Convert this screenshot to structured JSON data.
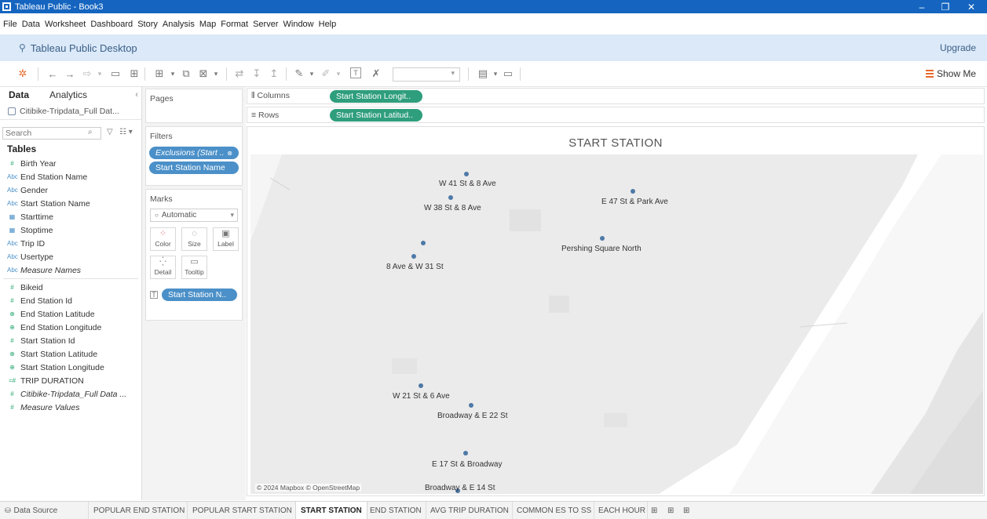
{
  "window": {
    "title": "Tableau Public - Book3",
    "controls": {
      "minimize": "–",
      "restore": "❐",
      "close": "✕"
    }
  },
  "menu": [
    "File",
    "Data",
    "Worksheet",
    "Dashboard",
    "Story",
    "Analysis",
    "Map",
    "Format",
    "Server",
    "Window",
    "Help"
  ],
  "header": {
    "product": "Tableau Public Desktop",
    "upgrade": "Upgrade"
  },
  "toolbar": {
    "show_me": "Show Me"
  },
  "data_pane": {
    "tabs": {
      "data": "Data",
      "analytics": "Analytics"
    },
    "datasource": "Citibike-Tripdata_Full Dat...",
    "search_placeholder": "Search",
    "tables_heading": "Tables",
    "fields": [
      {
        "type": "#",
        "name": "Birth Year"
      },
      {
        "type": "Abc",
        "name": "End Station Name"
      },
      {
        "type": "Abc",
        "name": "Gender"
      },
      {
        "type": "Abc",
        "name": "Start Station Name"
      },
      {
        "type": "dt",
        "name": "Starttime"
      },
      {
        "type": "dt",
        "name": "Stoptime"
      },
      {
        "type": "Abc",
        "name": "Trip ID"
      },
      {
        "type": "Abc",
        "name": "Usertype"
      },
      {
        "type": "Abc",
        "name": "Measure Names"
      },
      {
        "type": "#",
        "name": "Bikeid"
      },
      {
        "type": "#",
        "name": "End Station Id"
      },
      {
        "type": "geo",
        "name": "End Station Latitude"
      },
      {
        "type": "geo",
        "name": "End Station Longitude"
      },
      {
        "type": "#",
        "name": "Start Station Id"
      },
      {
        "type": "geo",
        "name": "Start Station Latitude"
      },
      {
        "type": "geo",
        "name": "Start Station Longitude"
      },
      {
        "type": "=#",
        "name": "TRIP DURATION"
      },
      {
        "type": "#",
        "name": "Citibike-Tripdata_Full Data ..."
      },
      {
        "type": "#",
        "name": "Measure Values"
      }
    ]
  },
  "cards": {
    "pages": "Pages",
    "filters": {
      "title": "Filters",
      "pills": [
        "Exclusions (Start ..",
        "Start Station Name"
      ]
    },
    "marks": {
      "title": "Marks",
      "type": "Automatic",
      "buttons": [
        "Color",
        "Size",
        "Label",
        "Detail",
        "Tooltip"
      ],
      "label_pill": "Start Station N.."
    }
  },
  "shelves": {
    "columns_label": "Columns",
    "columns_pill": "Start Station Longit..",
    "rows_label": "Rows",
    "rows_pill": "Start Station Latitud.."
  },
  "view": {
    "title": "START STATION",
    "map_copyright": "© 2024 Mapbox © OpenStreetMap",
    "stations": [
      {
        "name": "W 41 St & 8 Ave"
      },
      {
        "name": "W 38 St & 8 Ave"
      },
      {
        "name": "E 47 St & Park Ave"
      },
      {
        "name": "Pershing Square North"
      },
      {
        "name": "8 Ave & W 31 St"
      },
      {
        "name": "W 21 St & 6 Ave"
      },
      {
        "name": "Broadway & E 22 St"
      },
      {
        "name": "E 17 St & Broadway"
      },
      {
        "name": "Broadway & E 14 St"
      }
    ]
  },
  "sheet_tabs": {
    "data_source": "Data Source",
    "sheets": [
      "POPULAR END STATION",
      "POPULAR START STATION",
      "START STATION",
      "END STATION",
      "AVG TRIP DURATION",
      "COMMON ES TO SS",
      "EACH HOUR"
    ],
    "active": "START STATION"
  }
}
